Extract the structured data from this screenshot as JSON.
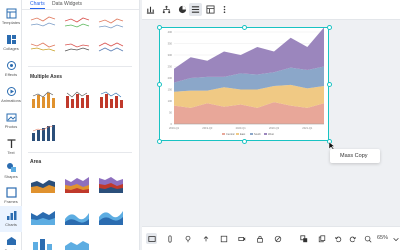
{
  "rail": {
    "items": [
      {
        "label": "Templates",
        "icon": "templates-icon"
      },
      {
        "label": "Collages",
        "icon": "collages-icon"
      },
      {
        "label": "Effects",
        "icon": "effects-icon"
      },
      {
        "label": "Animations",
        "icon": "animations-icon"
      },
      {
        "label": "Photos",
        "icon": "photos-icon"
      },
      {
        "label": "Text",
        "icon": "text-icon"
      },
      {
        "label": "Shapes",
        "icon": "shapes-icon"
      },
      {
        "label": "Frames",
        "icon": "frames-icon"
      },
      {
        "label": "Charts",
        "icon": "charts-icon"
      },
      {
        "label": "Brands",
        "icon": "brands-icon"
      }
    ]
  },
  "panel": {
    "tabs": [
      "Charts",
      "Data Widgets"
    ],
    "sections": [
      "Multiple Axes",
      "Area"
    ]
  },
  "toolbar": {
    "icons": [
      "chart-type-icon",
      "hierarchy-icon",
      "pie-icon",
      "align-icon",
      "data-table-icon",
      "more-icon"
    ]
  },
  "context_menu": {
    "item": "Mass Copy"
  },
  "bottom": {
    "zoom": "65%"
  },
  "chart_data": {
    "type": "area",
    "categories": [
      "2019-Q1",
      "2019-Q2",
      "2019-Q3",
      "2019-Q4",
      "2020-Q1",
      "2020-Q2",
      "2020-Q3",
      "2020-Q4",
      "2021-Q1",
      "2021-Q2"
    ],
    "series": [
      {
        "name": "Central",
        "color": "#e8a799",
        "values": [
          80,
          70,
          90,
          75,
          85,
          70,
          95,
          80,
          70,
          90
        ]
      },
      {
        "name": "East",
        "color": "#f0c984",
        "values": [
          60,
          75,
          55,
          85,
          65,
          80,
          70,
          90,
          85,
          75
        ]
      },
      {
        "name": "South",
        "color": "#8ba7c9",
        "values": [
          40,
          55,
          60,
          45,
          70,
          65,
          60,
          75,
          80,
          85
        ]
      },
      {
        "name": "West",
        "color": "#9b86bd",
        "values": [
          60,
          90,
          70,
          110,
          80,
          120,
          90,
          130,
          100,
          170
        ]
      }
    ],
    "ylim": [
      0,
      400
    ],
    "grid": true,
    "legend": "bottom",
    "title": "",
    "xlabel": "",
    "ylabel": ""
  },
  "colors": {
    "accent": "#2563eb",
    "selection": "#19c3c3"
  }
}
